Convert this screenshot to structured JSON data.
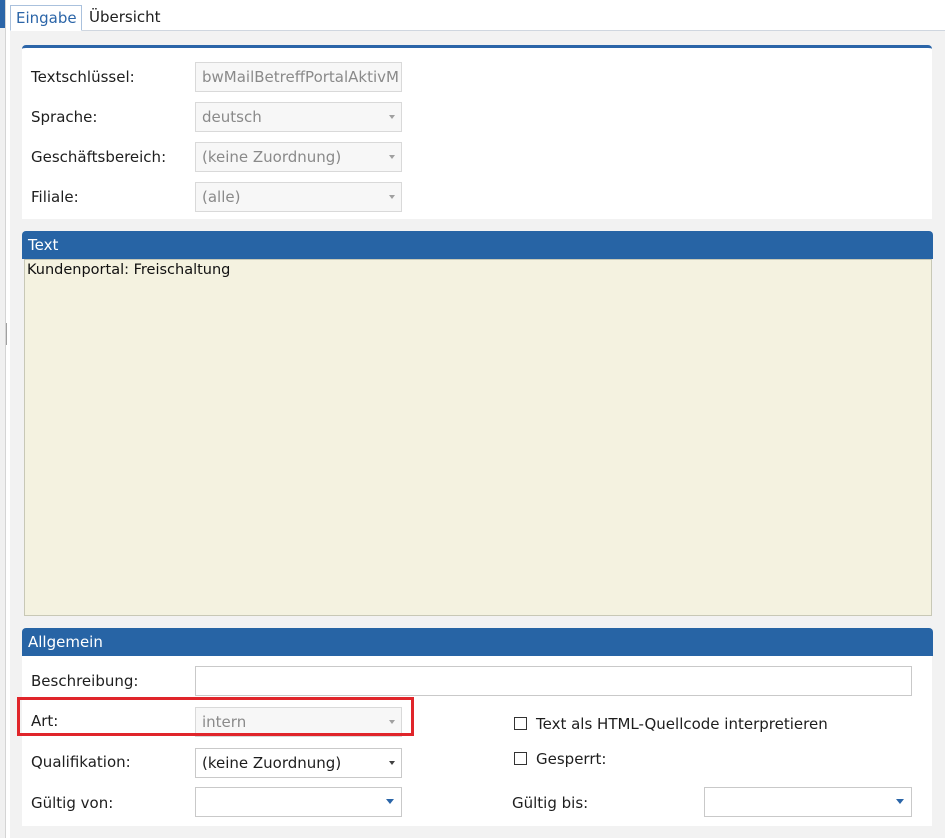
{
  "tabs": {
    "eingabe": "Eingabe",
    "uebersicht": "Übersicht"
  },
  "top_form": {
    "textschluessel_label": "Textschlüssel:",
    "textschluessel_value": "bwMailBetreffPortalAktivM",
    "sprache_label": "Sprache:",
    "sprache_value": "deutsch",
    "geschaeftsbereich_label": "Geschäftsbereich:",
    "geschaeftsbereich_value": "(keine Zuordnung)",
    "filiale_label": "Filiale:",
    "filiale_value": "(alle)"
  },
  "text_section": {
    "header": "Text",
    "content": "Kundenportal: Freischaltung"
  },
  "allgemein": {
    "header": "Allgemein",
    "beschreibung_label": "Beschreibung:",
    "beschreibung_value": "",
    "art_label": "Art:",
    "art_value": "intern",
    "html_checkbox_label": "Text als HTML-Quellcode interpretieren",
    "html_checked": false,
    "qualifikation_label": "Qualifikation:",
    "qualifikation_value": "(keine Zuordnung)",
    "gesperrt_label": "Gesperrt:",
    "gesperrt_checked": false,
    "gueltig_von_label": "Gültig von:",
    "gueltig_von_value": "",
    "gueltig_bis_label": "Gültig bis:",
    "gueltig_bis_value": ""
  },
  "colors": {
    "accent": "#2764a5",
    "text_bg": "#f4f2e0",
    "highlight": "#e0252a"
  }
}
